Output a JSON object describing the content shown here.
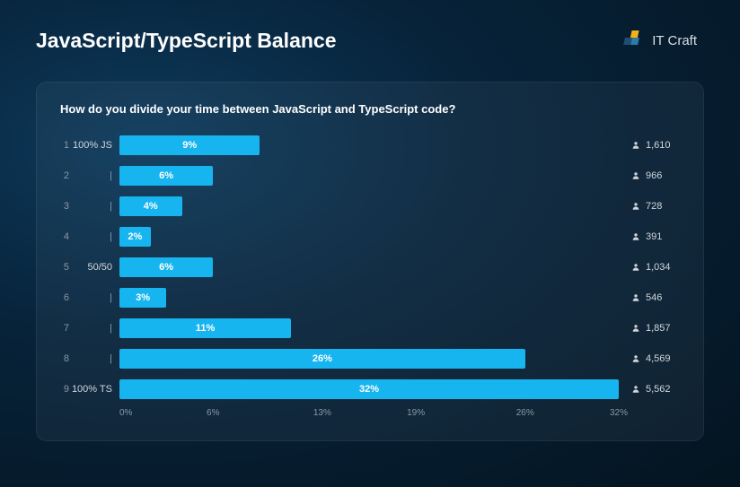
{
  "header": {
    "title": "JavaScript/TypeScript Balance",
    "logo_text": "IT Craft"
  },
  "chart_data": {
    "type": "bar",
    "orientation": "horizontal",
    "title": "How do you divide your time between JavaScript and TypeScript code?",
    "xlabel": "",
    "ylabel": "",
    "xlim": [
      0,
      32
    ],
    "x_ticks": [
      "0%",
      "6%",
      "13%",
      "19%",
      "26%",
      "32%"
    ],
    "x_tick_values": [
      0,
      6,
      13,
      19,
      26,
      32
    ],
    "categories": [
      "100% JS",
      "|",
      "|",
      "|",
      "50/50",
      "|",
      "|",
      "|",
      "100% TS"
    ],
    "series": [
      {
        "name": "Share",
        "values": [
          9,
          6,
          4,
          2,
          6,
          3,
          11,
          26,
          32
        ]
      }
    ],
    "data_labels": [
      "9%",
      "6%",
      "4%",
      "2%",
      "6%",
      "3%",
      "11%",
      "26%",
      "32%"
    ],
    "respondent_counts": [
      "1,610",
      "966",
      "728",
      "391",
      "1,034",
      "546",
      "1,857",
      "4,569",
      "5,562"
    ],
    "bar_color": "#17b5ef"
  }
}
